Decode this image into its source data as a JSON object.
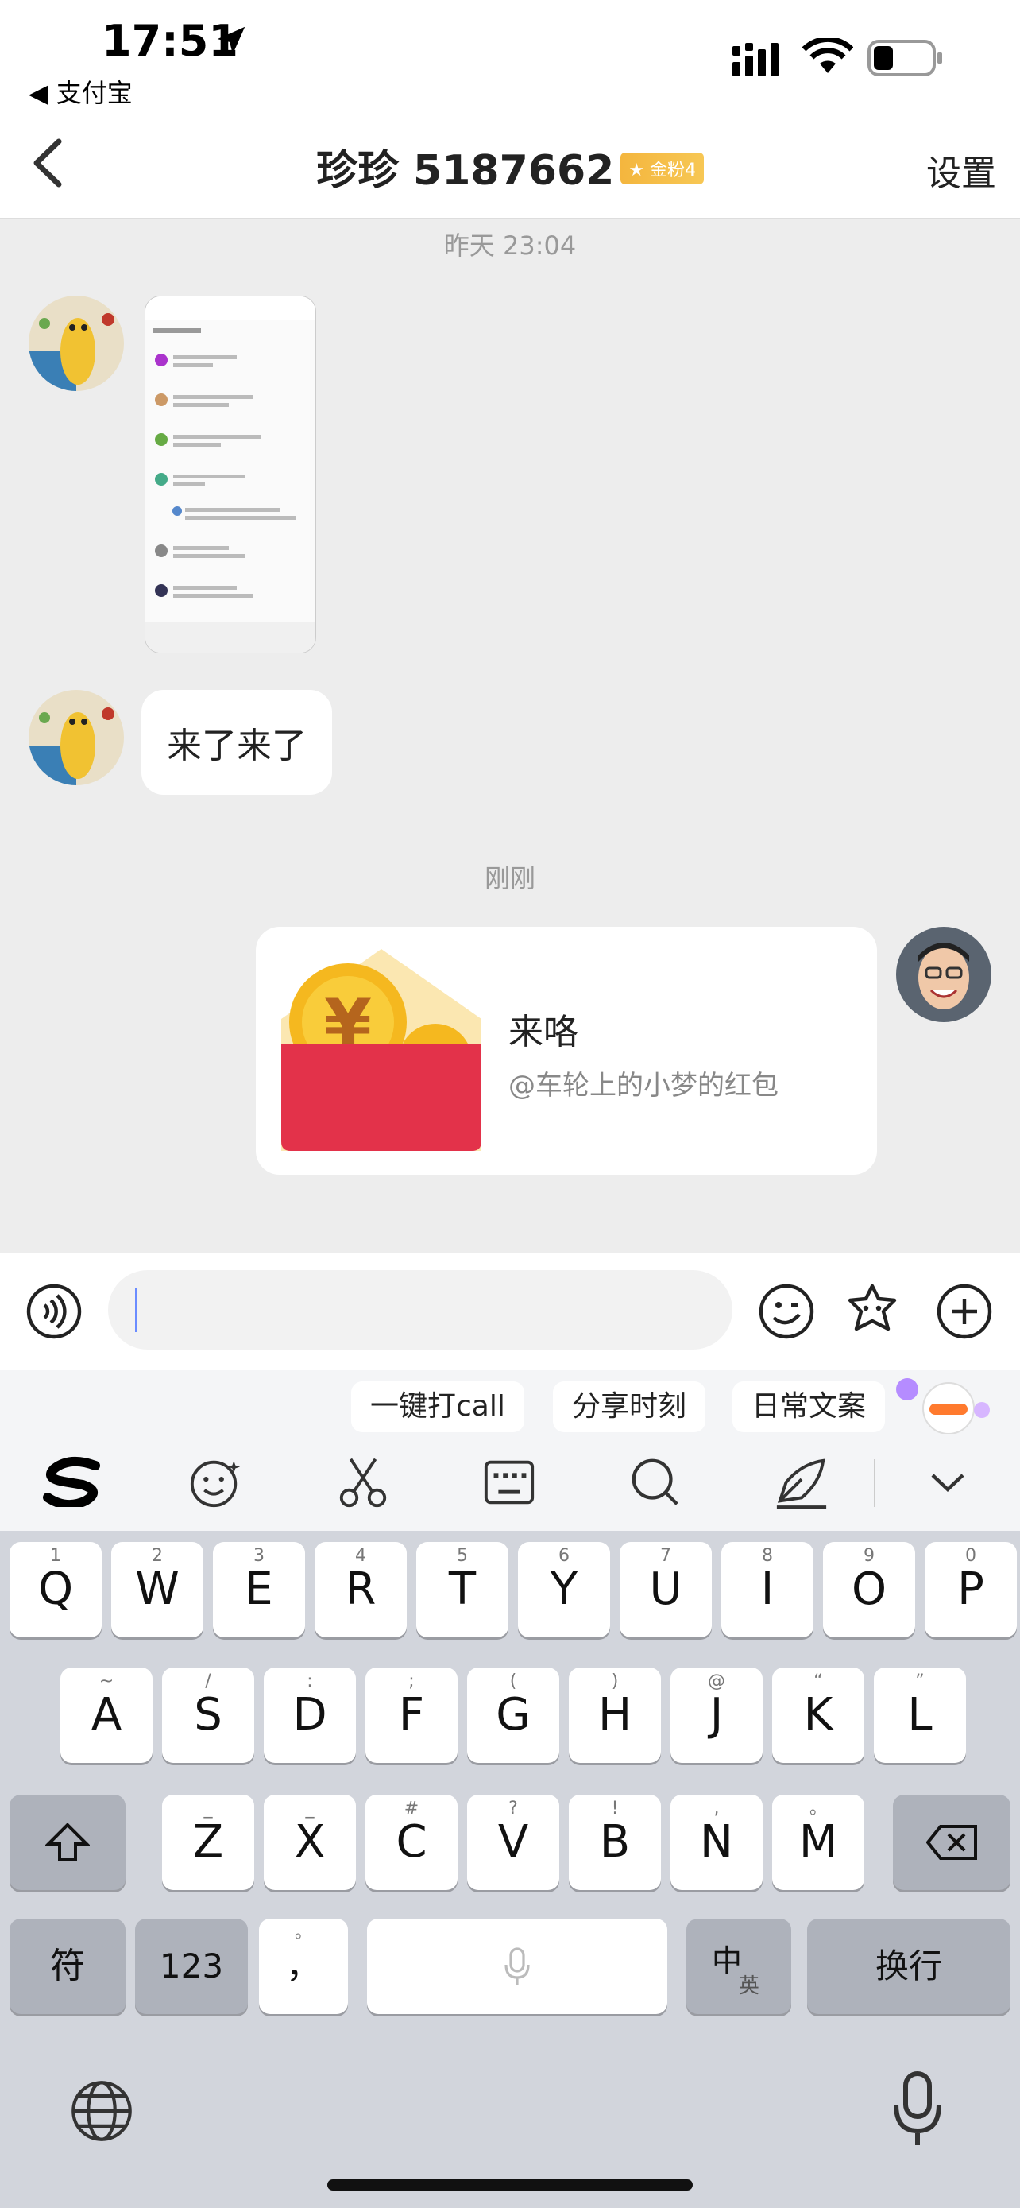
{
  "status_bar": {
    "time": "17:51",
    "back_app": "◀ 支付宝"
  },
  "nav": {
    "title": "珍珍 5187662",
    "badge": "金粉4",
    "settings": "设置"
  },
  "chat": {
    "timestamp_1": "昨天 23:04",
    "message_text": "来了来了",
    "timestamp_2": "刚刚",
    "red_packet": {
      "title": "来咯",
      "subtitle": "@车轮上的小梦的红包"
    }
  },
  "keyboard": {
    "suggestions": [
      "一键打call",
      "分享时刻",
      "日常文案"
    ],
    "row1": [
      {
        "k": "Q",
        "s": "1"
      },
      {
        "k": "W",
        "s": "2"
      },
      {
        "k": "E",
        "s": "3"
      },
      {
        "k": "R",
        "s": "4"
      },
      {
        "k": "T",
        "s": "5"
      },
      {
        "k": "Y",
        "s": "6"
      },
      {
        "k": "U",
        "s": "7"
      },
      {
        "k": "I",
        "s": "8"
      },
      {
        "k": "O",
        "s": "9"
      },
      {
        "k": "P",
        "s": "0"
      }
    ],
    "row2": [
      {
        "k": "A",
        "s": "~"
      },
      {
        "k": "S",
        "s": "/"
      },
      {
        "k": "D",
        "s": ":"
      },
      {
        "k": "F",
        "s": ";"
      },
      {
        "k": "G",
        "s": "("
      },
      {
        "k": "H",
        "s": ")"
      },
      {
        "k": "J",
        "s": "@"
      },
      {
        "k": "K",
        "s": "“"
      },
      {
        "k": "L",
        "s": "”"
      }
    ],
    "row3": [
      {
        "k": "Z",
        "s": "_"
      },
      {
        "k": "X",
        "s": "_"
      },
      {
        "k": "C",
        "s": "#"
      },
      {
        "k": "V",
        "s": "?"
      },
      {
        "k": "B",
        "s": "!"
      },
      {
        "k": "N",
        "s": ","
      },
      {
        "k": "M",
        "s": "。"
      }
    ],
    "symbols": "符",
    "numbers": "123",
    "punct": "，",
    "punct_top": "。",
    "lang_main": "中",
    "lang_sub": "英",
    "enter": "换行"
  },
  "colors": {
    "red_packet": "#e3324a",
    "badge": "#f4b63e"
  }
}
